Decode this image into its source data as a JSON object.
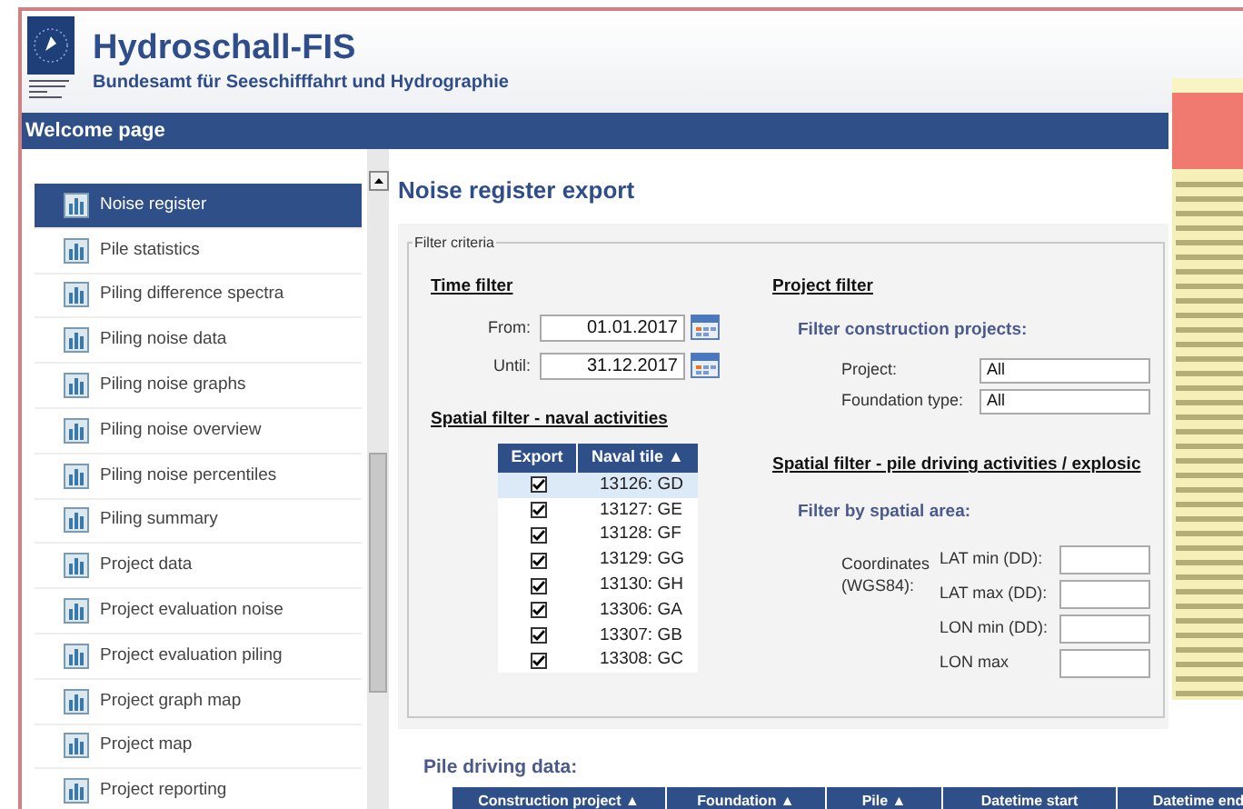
{
  "header": {
    "title": "Hydroschall-FIS",
    "subtitle": "Bundesamt für Seeschifffahrt und Hydrographie"
  },
  "nav_bar": {
    "label": "Welcome page"
  },
  "sidebar": {
    "items": [
      {
        "label": "Noise register",
        "selected": true
      },
      {
        "label": "Pile statistics",
        "selected": false
      },
      {
        "label": "Piling difference spectra",
        "selected": false
      },
      {
        "label": "Piling noise data",
        "selected": false
      },
      {
        "label": "Piling noise graphs",
        "selected": false
      },
      {
        "label": "Piling noise overview",
        "selected": false
      },
      {
        "label": "Piling noise percentiles",
        "selected": false
      },
      {
        "label": "Piling summary",
        "selected": false
      },
      {
        "label": "Project data",
        "selected": false
      },
      {
        "label": "Project evaluation noise",
        "selected": false
      },
      {
        "label": "Project evaluation piling",
        "selected": false
      },
      {
        "label": "Project graph map",
        "selected": false
      },
      {
        "label": "Project map",
        "selected": false
      },
      {
        "label": "Project reporting",
        "selected": false
      }
    ]
  },
  "page_title": "Noise register export",
  "filter": {
    "legend": "Filter criteria",
    "time_filter": {
      "heading": "Time filter",
      "fields": [
        {
          "label": "From:",
          "value": "01.01.2017"
        },
        {
          "label": "Until:",
          "value": "31.12.2017"
        }
      ]
    },
    "naval": {
      "heading": "Spatial filter - naval activities",
      "columns": [
        "Export",
        "Naval tile ▲"
      ],
      "rows": [
        {
          "tile": "13126: GD",
          "checked": true,
          "selected": true
        },
        {
          "tile": "13127: GE",
          "checked": true,
          "selected": false
        },
        {
          "tile": "13128: GF",
          "checked": true,
          "selected": false
        },
        {
          "tile": "13129: GG",
          "checked": true,
          "selected": false
        },
        {
          "tile": "13130: GH",
          "checked": true,
          "selected": false
        },
        {
          "tile": "13306: GA",
          "checked": true,
          "selected": false
        },
        {
          "tile": "13307: GB",
          "checked": true,
          "selected": false
        },
        {
          "tile": "13308: GC",
          "checked": true,
          "selected": false
        }
      ]
    },
    "project_filter": {
      "heading": "Project filter",
      "subheading": "Filter construction projects:",
      "fields": [
        {
          "label": "Project:",
          "value": "All"
        },
        {
          "label": "Foundation type:",
          "value": "All"
        }
      ]
    },
    "spatial": {
      "heading": "Spatial filter - pile driving activities / explosic",
      "subheading": "Filter by spatial area:",
      "coord_label": "Coordinates (WGS84):",
      "fields": [
        {
          "label": "LAT min (DD):"
        },
        {
          "label": "LAT max (DD):"
        },
        {
          "label": "LON min (DD):"
        },
        {
          "label": "LON max"
        }
      ]
    }
  },
  "pile_data": {
    "heading": "Pile driving data:",
    "columns": [
      "Construction project ▲",
      "Foundation ▲",
      "Pile ▲",
      "Datetime start",
      "Datetime end"
    ]
  }
}
